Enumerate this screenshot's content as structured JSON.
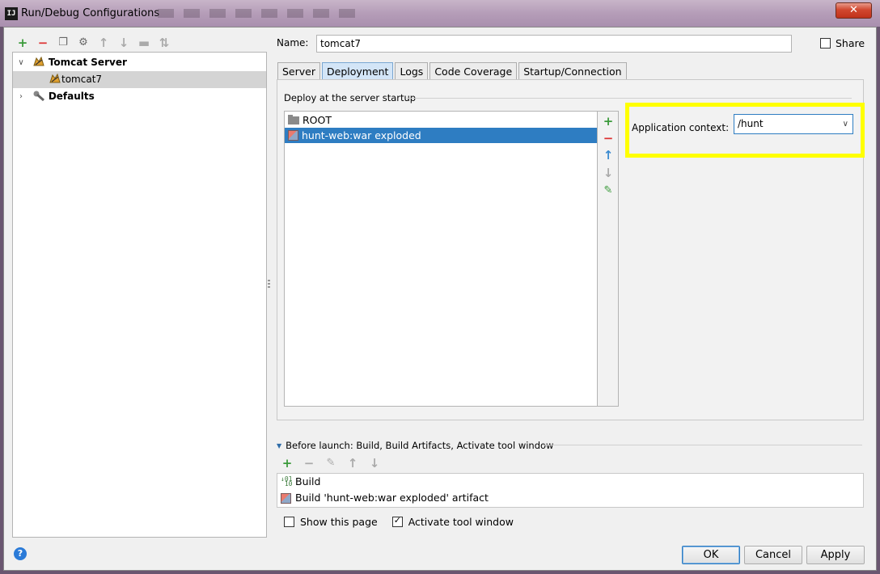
{
  "window": {
    "title": "Run/Debug Configurations",
    "app_icon": "IJ",
    "close_symbol": "✕"
  },
  "left_toolbar": {
    "icons": [
      "add-icon",
      "remove-icon",
      "copy-icon",
      "wrench-icon",
      "move-up-icon",
      "move-down-icon",
      "folder-icon",
      "sort-icon"
    ],
    "glyphs": {
      "add": "+",
      "remove": "−",
      "copy": "❐",
      "wrench": "⚙",
      "up": "↑",
      "down": "↓",
      "folder": "▬",
      "sort": "⇅"
    }
  },
  "tree": {
    "items": [
      {
        "label": "Tomcat Server",
        "expanded": true,
        "bold": true,
        "arrow": "∨"
      },
      {
        "label": "tomcat7",
        "selected": true
      },
      {
        "label": "Defaults",
        "expanded": false,
        "bold": true,
        "arrow": "›"
      }
    ]
  },
  "help_symbol": "?",
  "config": {
    "name_label": "Name:",
    "name_value": "tomcat7",
    "share_label": "Share",
    "share_checked": false
  },
  "tabs": [
    "Server",
    "Deployment",
    "Logs",
    "Code Coverage",
    "Startup/Connection"
  ],
  "active_tab": "Deployment",
  "deployment": {
    "section_title": "Deploy at the server startup",
    "items": [
      {
        "label": "ROOT",
        "icon": "folder-icon",
        "selected": false
      },
      {
        "label": "hunt-web:war exploded",
        "icon": "war-artifact-icon",
        "selected": true
      }
    ],
    "side_tools": {
      "add": "+",
      "remove": "−",
      "up": "↑",
      "down": "↓",
      "edit": "✎"
    },
    "context_label": "Application context:",
    "context_value": "/hunt",
    "context_chevron": "∨",
    "highlight_color": "#ffff00"
  },
  "before_launch": {
    "title": "Before launch: Build, Build Artifacts, Activate tool window",
    "tools": {
      "add": "+",
      "remove": "−",
      "edit": "✎",
      "up": "↑",
      "down": "↓"
    },
    "items": [
      {
        "label": "Build",
        "icon": "build-icon"
      },
      {
        "label": "Build 'hunt-web:war exploded' artifact",
        "icon": "artifact-icon"
      }
    ]
  },
  "options": {
    "show_this_page_label": "Show this page",
    "show_this_page_checked": false,
    "activate_tool_window_label": "Activate tool window",
    "activate_tool_window_checked": true
  },
  "buttons": {
    "ok": "OK",
    "cancel": "Cancel",
    "apply": "Apply"
  },
  "colors": {
    "selection": "#2e7dc2",
    "active_tab": "#d3e5f7",
    "add_green": "#3a9a3a",
    "remove_red": "#dd3333"
  }
}
